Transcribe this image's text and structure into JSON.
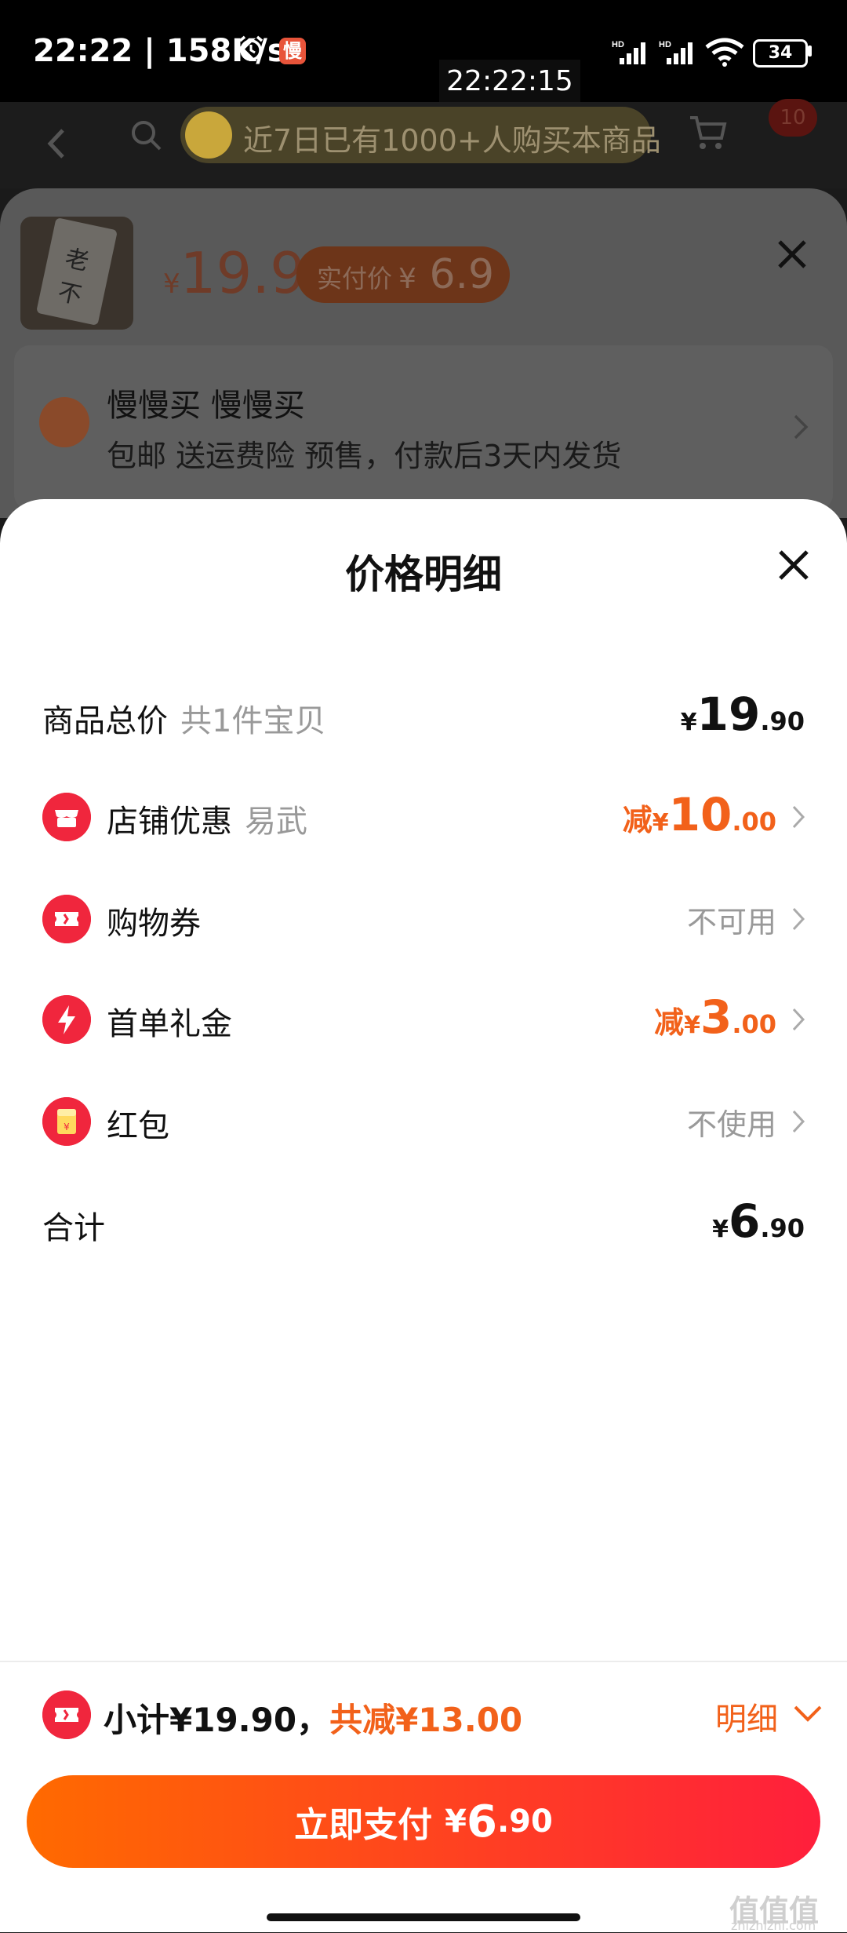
{
  "status": {
    "time_speed": "22:22 | 158K/s",
    "app_badge": "慢",
    "battery": "34"
  },
  "overlay_clock": "22:22:15",
  "nav": {
    "promo_text": "近7日已有1000+人购买本商品",
    "msg_count": "10"
  },
  "product": {
    "price_symbol": "¥",
    "price": "19.9",
    "actual_label": "实付价",
    "actual_symbol": "¥",
    "actual_price": "6.9",
    "thumb_text": "老不"
  },
  "address": {
    "name": "慢慢买 慢慢买",
    "sub": "包邮 送运费险 预售，付款后3天内发货"
  },
  "popup": {
    "title": "价格明细",
    "rows": [
      {
        "label": "商品总价",
        "sub": "共1件宝贝",
        "symbol": "¥",
        "int": "19",
        "dec": ".90",
        "icon": "none"
      },
      {
        "label": "店铺优惠",
        "sub": "易武",
        "prefix": "减",
        "symbol": "¥",
        "int": "10",
        "dec": ".00",
        "icon": "store-icon",
        "color": "#f2611a"
      },
      {
        "label": "购物券",
        "status": "不可用",
        "icon": "ticket-icon"
      },
      {
        "label": "首单礼金",
        "prefix": "减",
        "symbol": "¥",
        "int": "3",
        "dec": ".00",
        "icon": "lightning-icon",
        "color": "#f2611a"
      },
      {
        "label": "红包",
        "status": "不使用",
        "icon": "red-envelope-icon"
      },
      {
        "label": "合计",
        "symbol": "¥",
        "int": "6",
        "dec": ".90",
        "icon": "none"
      }
    ]
  },
  "bottom": {
    "subtotal": "小计¥19.90，",
    "reduce": "共减¥13.00",
    "detail": "明细",
    "pay_label": "立即支付",
    "pay_symbol": "¥",
    "pay_int": "6",
    "pay_dec": ".90",
    "watermark": "值值值",
    "watermark_sub": "zhizhizhi.com"
  },
  "colors": {
    "accent_orange": "#f2611a",
    "accent_red": "#f0263d",
    "pay_gradient_start": "#ff6a00",
    "pay_gradient_end": "#ff1f3c"
  }
}
